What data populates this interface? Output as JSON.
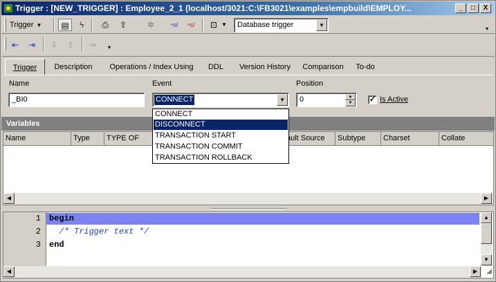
{
  "window": {
    "title": "Trigger : [NEW_TRIGGER] : Employee_2_1 (localhost/3021:C:\\FB3021\\examples\\empbuild\\EMPLOY...",
    "min": "_",
    "max": "□",
    "close": "X"
  },
  "toolbar1": {
    "trigger_menu": "Trigger",
    "trigger_type": "Database trigger",
    "icons": [
      "grid-icon",
      "lightning-icon",
      "print-icon",
      "export-icon",
      "debug-icon",
      "sql-icon",
      "sql-red-icon",
      "properties-icon"
    ]
  },
  "tabs": [
    "Trigger",
    "Description",
    "Operations / Index Using",
    "DDL",
    "Version History",
    "Comparison",
    "To-do"
  ],
  "form": {
    "name_label": "Name",
    "name_value": "_BI0",
    "event_label": "Event",
    "event_value": "CONNECT",
    "position_label": "Position",
    "position_value": "0",
    "active_label": "Is Active",
    "active_checked": true
  },
  "event_options": [
    {
      "label": "CONNECT",
      "selected": false
    },
    {
      "label": "DISCONNECT",
      "selected": true
    },
    {
      "label": "TRANSACTION START",
      "selected": false
    },
    {
      "label": "TRANSACTION COMMIT",
      "selected": false
    },
    {
      "label": "TRANSACTION ROLLBACK",
      "selected": false
    }
  ],
  "variables": {
    "title": "Variables",
    "columns": [
      "Name",
      "Type",
      "TYPE OF",
      "ault Source",
      "Subtype",
      "Charset",
      "Collate"
    ]
  },
  "editor": {
    "lines": [
      {
        "num": "1",
        "text": "begin"
      },
      {
        "num": "2",
        "text": "  /* Trigger text */"
      },
      {
        "num": "3",
        "text": "end"
      }
    ]
  },
  "colors": {
    "title_start": "#0a246a",
    "title_end": "#a6caf0",
    "selection": "#0a246a",
    "highlight_line": "#7b84f0"
  }
}
